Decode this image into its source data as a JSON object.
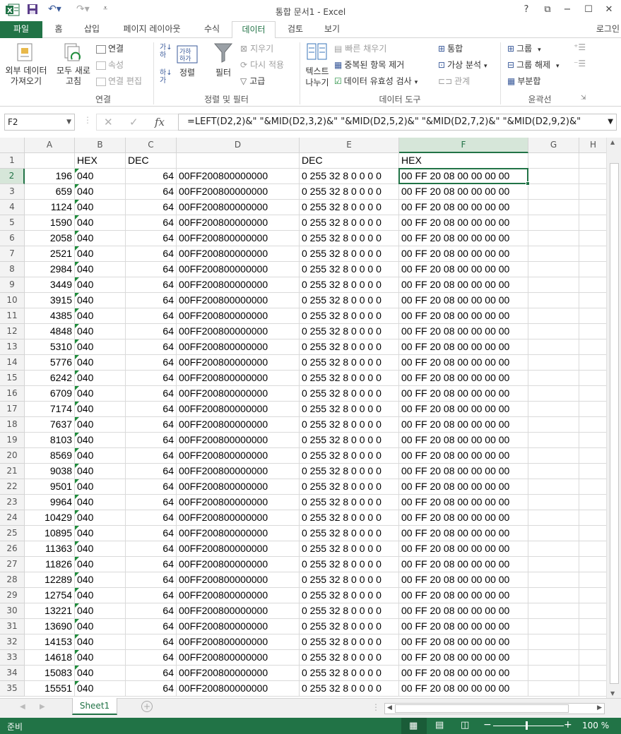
{
  "titlebar": {
    "title": "통합 문서1 - Excel",
    "help": "?",
    "restore": "⧉",
    "minimize": "−",
    "maximize": "☐",
    "close": "✕"
  },
  "tabs": [
    {
      "label": "파일"
    },
    {
      "label": "홈"
    },
    {
      "label": "삽입"
    },
    {
      "label": "페이지 레이아웃"
    },
    {
      "label": "수식"
    },
    {
      "label": "데이터"
    },
    {
      "label": "검토"
    },
    {
      "label": "보기"
    }
  ],
  "login": "로그인",
  "ribbon": {
    "external_data": "외부 데이터\n가져오기",
    "refresh_all": "모두 새로\n고침",
    "connections": "연결",
    "properties": "속성",
    "edit_links": "연결 편집",
    "group_connections": "연결",
    "sort": "정렬",
    "filter": "필터",
    "clear": "지우기",
    "reapply": "다시 적용",
    "advanced": "고급",
    "group_sort_filter": "정렬 및 필터",
    "text_to_columns": "텍스트\n나누기",
    "flash_fill": "빠른 채우기",
    "remove_duplicates": "중복된 항목 제거",
    "data_validation": "데이터 유효성 검사",
    "consolidate": "통합",
    "what_if": "가상 분석",
    "relationships": "관계",
    "group_data_tools": "데이터 도구",
    "group": "그룹",
    "ungroup": "그룹 해제",
    "subtotal": "부분합",
    "group_outline": "윤곽선"
  },
  "formula_bar": {
    "name_box": "F2",
    "formula": "=LEFT(D2,2)&\" \"&MID(D2,3,2)&\" \"&MID(D2,5,2)&\" \"&MID(D2,7,2)&\" \"&MID(D2,9,2)&\""
  },
  "columns": [
    "A",
    "B",
    "C",
    "D",
    "E",
    "F",
    "G",
    "H"
  ],
  "header_row": {
    "a": "",
    "b": "HEX",
    "c": "DEC",
    "d": "",
    "e": "DEC",
    "f": "HEX"
  },
  "col_values": {
    "b": "040",
    "c": "64",
    "d": "00FF200800000000",
    "e": "0 255 32 8 0 0 0 0",
    "f": "00 FF 20 08 00 00 00 00"
  },
  "a_values": [
    "196",
    "659",
    "1124",
    "1590",
    "2058",
    "2521",
    "2984",
    "3449",
    "3915",
    "4385",
    "4848",
    "5310",
    "5776",
    "6242",
    "6709",
    "7174",
    "7637",
    "8103",
    "8569",
    "9038",
    "9501",
    "9964",
    "10429",
    "10895",
    "11363",
    "11826",
    "12289",
    "12754",
    "13221",
    "13690",
    "14153",
    "14618",
    "15083",
    "15551"
  ],
  "row_numbers": [
    "1",
    "2",
    "3",
    "4",
    "5",
    "6",
    "7",
    "8",
    "9",
    "10",
    "11",
    "12",
    "13",
    "14",
    "15",
    "16",
    "17",
    "18",
    "19",
    "20",
    "21",
    "22",
    "23",
    "24",
    "25",
    "26",
    "27",
    "28",
    "29",
    "30",
    "31",
    "32",
    "33",
    "34",
    "35"
  ],
  "sheet_tab": "Sheet1",
  "status": {
    "ready": "준비",
    "zoom": "100 %"
  }
}
